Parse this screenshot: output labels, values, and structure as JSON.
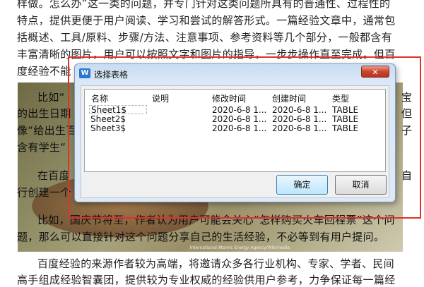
{
  "article": {
    "lines_top": [
      "样做。怎么办”这一类的问题，并专门针对这类问题所具有的普通性、过程性的",
      "特点，提供更便于用户阅读、学习和尝试的解答形式。一篇经验文章中，通常包",
      "括概述、工具/原料、步骤/方法、注意事项、参考资料等几个部分，一般都含有",
      "丰富清晰的图片，用户可以按照文字和图片的指导，一步步操作直至完成。但百",
      "度经验不能"
    ],
    "photo_lines": [
      {
        "left": "比如“",
        "right": "宝"
      },
      {
        "left": "的出生日期",
        "right": "但"
      },
      {
        "left": "像“给出生百",
        "right": "子"
      },
      {
        "left": "含有学生“",
        "right": ""
      },
      {
        "left": "在百度",
        "right": "自"
      },
      {
        "left": "行创建一个",
        "right": ""
      },
      {
        "left": "比如，国庆节将至，作者认为用户可能会关心“怎样购买火车回程票”这个问",
        "right": ""
      },
      {
        "left": "题，那么可以直接针对这个问题分享自己的生活经验，不必等到有用户提问。",
        "right": ""
      }
    ],
    "photo_credit": "International Atomic Energy Agency/Wikimedia",
    "lines_bottom": [
      "百度经验的来源作者较为高端，将邀请众多各行业机构、专家、学者、民间",
      "高手组成经验智囊团，提供较为专业权威的经验供用户参考，力争保证每一篇经"
    ]
  },
  "dialog": {
    "title": "选择表格",
    "app_icon_letter": "W",
    "close_symbol": "✕",
    "columns": [
      "名称",
      "说明",
      "修改时间",
      "创建时间",
      "类型"
    ],
    "rows": [
      {
        "name": "Sheet1$",
        "desc": "",
        "modified": "2020-6-8 1...",
        "created": "2020-6-8 1...",
        "type": "TABLE"
      },
      {
        "name": "Sheet2$",
        "desc": "",
        "modified": "2020-6-8 1...",
        "created": "2020-6-8 1...",
        "type": "TABLE"
      },
      {
        "name": "Sheet3$",
        "desc": "",
        "modified": "2020-6-8 1...",
        "created": "2020-6-8 1...",
        "type": "TABLE"
      }
    ],
    "ok_label": "确定",
    "cancel_label": "取消"
  },
  "colors": {
    "highlight_border": "#e0312d",
    "dialog_border": "#7a9ac0",
    "close_button": "#c9452f"
  }
}
